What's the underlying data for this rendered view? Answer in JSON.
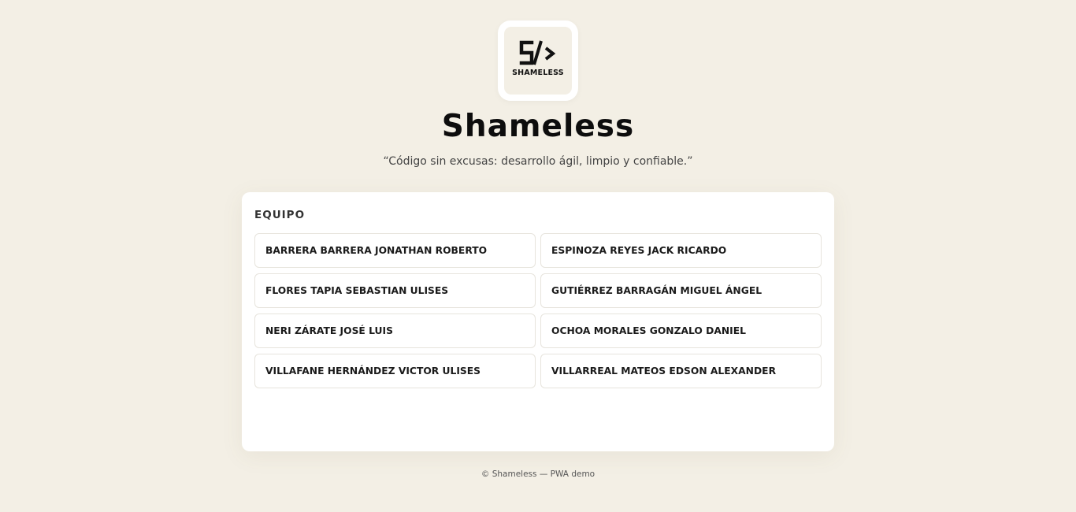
{
  "logo": {
    "text": "SHAMELESS",
    "icon": "s-code-icon"
  },
  "header": {
    "title": "Shameless",
    "tagline": "“Código sin excusas: desarrollo ágil, limpio y confiable.”"
  },
  "team": {
    "heading": "EQUIPO",
    "members": [
      "BARRERA BARRERA JONATHAN ROBERTO",
      "ESPINOZA REYES JACK RICARDO",
      "FLORES TAPIA SEBASTIAN ULISES",
      "GUTIÉRREZ BARRAGÁN MIGUEL ÁNGEL",
      "NERI ZÁRATE JOSÉ LUIS",
      "OCHOA MORALES GONZALO DANIEL",
      "VILLAFANE HERNÁNDEZ VICTOR ULISES",
      "VILLARREAL MATEOS EDSON ALEXANDER"
    ]
  },
  "footer": {
    "text": "© Shameless — PWA demo"
  },
  "colors": {
    "background": "#f3efe5",
    "card": "#ffffff",
    "text": "#1a1a1a"
  }
}
